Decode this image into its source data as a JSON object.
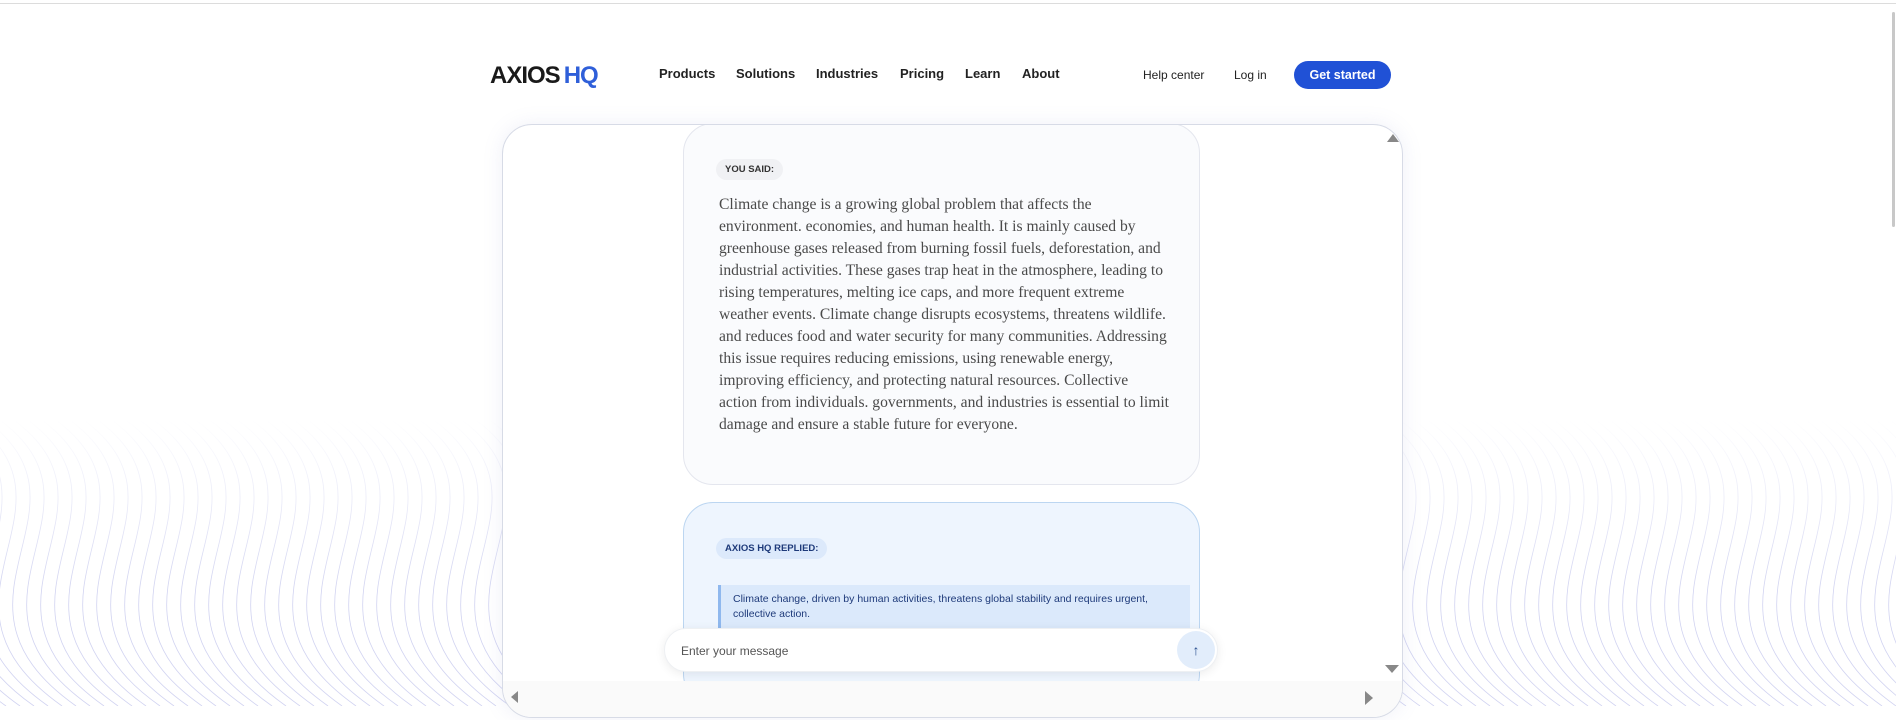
{
  "header": {
    "logo": {
      "main": "AXIOS",
      "accent": "HQ"
    },
    "nav": [
      "Products",
      "Solutions",
      "Industries",
      "Pricing",
      "Learn",
      "About"
    ],
    "help_center": "Help center",
    "log_in": "Log in",
    "get_started": "Get started"
  },
  "chat": {
    "user_label": "YOU SAID:",
    "user_message": "Climate change is a growing global problem that affects the environment. economies, and human health. It is mainly caused by greenhouse gases released from burning fossil fuels, deforestation, and industrial activities. These gases trap heat in the atmosphere, leading to rising temperatures, melting ice caps, and more frequent extreme weather events. Climate change disrupts ecosystems, threatens wildlife. and reduces food and water security for many communities. Addressing this issue requires reducing emissions, using renewable energy, improving efficiency, and protecting natural resources. Collective action from individuals. governments, and industries is essential to limit damage and ensure a stable future for everyone.",
    "reply_label": "AXIOS HQ REPLIED:",
    "reply_summary": "Climate change, driven by human activities, threatens global stability and requires urgent, collective action.",
    "input_placeholder": "Enter your message",
    "input_value": "",
    "send_icon": "arrow-up-icon"
  },
  "colors": {
    "accent": "#2051d6",
    "reply_bg": "#eef5fe",
    "wave": "#7c80d8"
  }
}
